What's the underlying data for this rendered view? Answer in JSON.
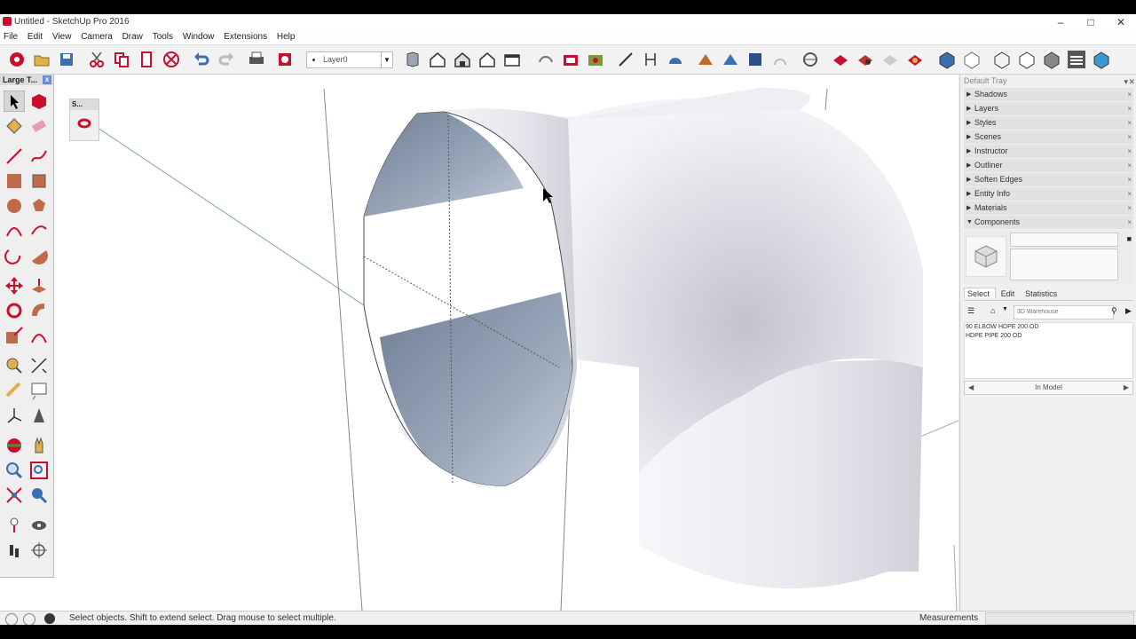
{
  "window": {
    "title": "Untitled - SketchUp Pro 2016"
  },
  "menu": [
    "File",
    "Edit",
    "View",
    "Camera",
    "Draw",
    "Tools",
    "Window",
    "Extensions",
    "Help"
  ],
  "toolbar": {
    "layer_value": "Layer0"
  },
  "large_toolset": {
    "title": "Large T...",
    "close": "x"
  },
  "small_panel": {
    "title": "S..."
  },
  "tray": {
    "title": "Default Tray",
    "panels": [
      "Shadows",
      "Layers",
      "Styles",
      "Scenes",
      "Instructor",
      "Outliner",
      "Soften Edges",
      "Entity Info",
      "Materials"
    ],
    "components": {
      "title": "Components",
      "tabs": [
        "Select",
        "Edit",
        "Statistics"
      ],
      "search_placeholder": "3D Warehouse",
      "items": [
        "90 ELBOW HDPE 200 OD",
        "HDPE PIPE 200 OD"
      ],
      "in_model": "In Model"
    }
  },
  "status": {
    "message": "Select objects. Shift to extend select. Drag mouse to select multiple.",
    "measurements_label": "Measurements"
  },
  "colors": {
    "accent_red": "#c8102e",
    "icon_blue": "#3a6fb0",
    "pipe_shade": "#7f8ea3"
  }
}
